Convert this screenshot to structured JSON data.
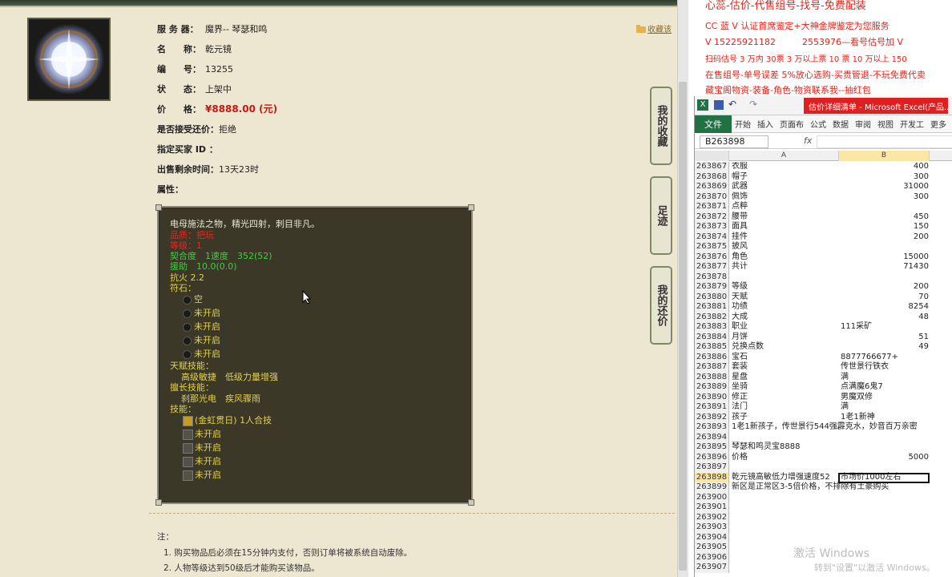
{
  "item": {
    "server_label": "服 务 器：",
    "server_value": "魔界-- 琴瑟和鸣",
    "name_label": "名　　称：",
    "name_value": "乾元镜",
    "id_label": "编　　号：",
    "id_value": "13255",
    "status_label": "状　　态：",
    "status_value": "上架中",
    "price_label": "价　　格：",
    "price_value": "¥8888.00 (元)",
    "bargain_label": "是否接受还价：",
    "bargain_value": "拒绝",
    "buyer_label": "指定买家 ID ：",
    "time_label": "出售剩余时间：",
    "time_value": "13天23时",
    "attr_label": "属性：",
    "fav_link": "收藏该"
  },
  "tooltip": {
    "desc": "电母施法之物，精光四射，刺目非凡。",
    "quality": "品质：把玩",
    "level": "等级：1",
    "fit": "契合度　1速度　352(52)",
    "assist": "援助　10.0(0.0)",
    "fire": "抗火 2.2",
    "rune_title": "符石：",
    "runes": [
      "空",
      "未开启",
      "未开启",
      "未开启",
      "未开启"
    ],
    "talent_title": "天赋技能：",
    "talents": "高级敏捷　低级力量增强",
    "expert_title": "擅长技能：",
    "experts": "刹那光电　疾风骤雨",
    "skill_title": "技能：",
    "skills": [
      "(金虹贯日) 1人合技",
      "未开启",
      "未开启",
      "未开启",
      "未开启"
    ]
  },
  "notes": {
    "title": "注：",
    "items": [
      "1. 购买物品后必须在15分钟内支付，否则订单将被系统自动废除。",
      "2. 人物等级达到50级后才能购买该物品。"
    ]
  },
  "side_tabs": [
    "我的收藏",
    "足迹",
    "我的还价"
  ],
  "promo": {
    "line0": "心蕊-估价-代售组号-找号-免费配装",
    "line1": "CC 蓝 V 认证首席鉴定+大神金牌鉴定为您服务",
    "line2": "V 15225921182　　　2553976—看号估号加 V",
    "line3": "扫码估号 3 万内 30票 3 万以上票 10 票 10 万以上 150",
    "line4": "在售组号-单号误差 5%放心选购-买贵管退-不玩免费代卖",
    "line5": "藏宝阁物资-装备-角色-物资联系我--抽红包"
  },
  "excel": {
    "title": "估价详细清单 - Microsoft Excel(产品...",
    "file_tab": "文件",
    "tabs": [
      "开始",
      "插入",
      "页面布",
      "公式",
      "数据",
      "审阅",
      "视图",
      "开发工",
      "更多"
    ],
    "namebox": "B263898",
    "fx": "fx",
    "col_a": "A",
    "col_b": "B",
    "rows": [
      {
        "n": "263867",
        "a": "衣服",
        "b": "400"
      },
      {
        "n": "263868",
        "a": "帽子",
        "b": "300"
      },
      {
        "n": "263869",
        "a": "武器",
        "b": "31000"
      },
      {
        "n": "263870",
        "a": "佩饰",
        "b": "300"
      },
      {
        "n": "263871",
        "a": "点粹",
        "b": ""
      },
      {
        "n": "263872",
        "a": "腰带",
        "b": "450"
      },
      {
        "n": "263873",
        "a": "面具",
        "b": "150"
      },
      {
        "n": "263874",
        "a": "挂件",
        "b": "200"
      },
      {
        "n": "263875",
        "a": "披风",
        "b": ""
      },
      {
        "n": "263876",
        "a": "角色",
        "b": "15000"
      },
      {
        "n": "263877",
        "a": "共计",
        "b": "71430"
      },
      {
        "n": "263878",
        "a": "",
        "b": ""
      },
      {
        "n": "263879",
        "a": "等级",
        "b": "200"
      },
      {
        "n": "263880",
        "a": "天赋",
        "b": "70"
      },
      {
        "n": "263881",
        "a": "功绩",
        "b": "8254"
      },
      {
        "n": "263882",
        "a": "大成",
        "b": "48"
      },
      {
        "n": "263883",
        "a": "职业",
        "bl": "111采矿"
      },
      {
        "n": "263884",
        "a": "月饼",
        "b": "51"
      },
      {
        "n": "263885",
        "a": "兑换点数",
        "b": "49"
      },
      {
        "n": "263886",
        "a": "宝石",
        "bl": "8877766677+"
      },
      {
        "n": "263887",
        "a": "套装",
        "bl": "传世景行铁衣"
      },
      {
        "n": "263888",
        "a": "星盘",
        "bl": "满"
      },
      {
        "n": "263889",
        "a": "坐骑",
        "bl": "点满魔6鬼7"
      },
      {
        "n": "263890",
        "a": "修正",
        "bl": "男魔双修"
      },
      {
        "n": "263891",
        "a": "法门",
        "bl": "满"
      },
      {
        "n": "263892",
        "a": "孩子",
        "bl": "1老1新神"
      },
      {
        "n": "263893",
        "a": "1老1新孩子，传世景行544强霹克水，妙音百万亲密",
        "b": ""
      },
      {
        "n": "263894",
        "a": "",
        "b": ""
      },
      {
        "n": "263895",
        "a": "琴瑟和鸣灵宝8888",
        "b": ""
      },
      {
        "n": "263896",
        "a": "价格",
        "b": "5000"
      },
      {
        "n": "263897",
        "a": "",
        "b": ""
      },
      {
        "n": "263898",
        "a": "乾元镜高敏低力增强速度52",
        "bl": "市场价1000左右",
        "sel": true
      },
      {
        "n": "263899",
        "a": "新区是正常区3-5倍价格，不排除有土豪购买",
        "b": ""
      },
      {
        "n": "263900",
        "a": "",
        "b": ""
      },
      {
        "n": "263901",
        "a": "",
        "b": ""
      },
      {
        "n": "263902",
        "a": "",
        "b": ""
      },
      {
        "n": "263903",
        "a": "",
        "b": ""
      },
      {
        "n": "263904",
        "a": "",
        "b": ""
      },
      {
        "n": "263905",
        "a": "",
        "b": ""
      },
      {
        "n": "263906",
        "a": "",
        "b": ""
      },
      {
        "n": "263907",
        "a": "",
        "b": ""
      }
    ]
  },
  "watermark": {
    "line1": "激活 Windows",
    "line2": "转到\"设置\"以激活 Windows。"
  }
}
